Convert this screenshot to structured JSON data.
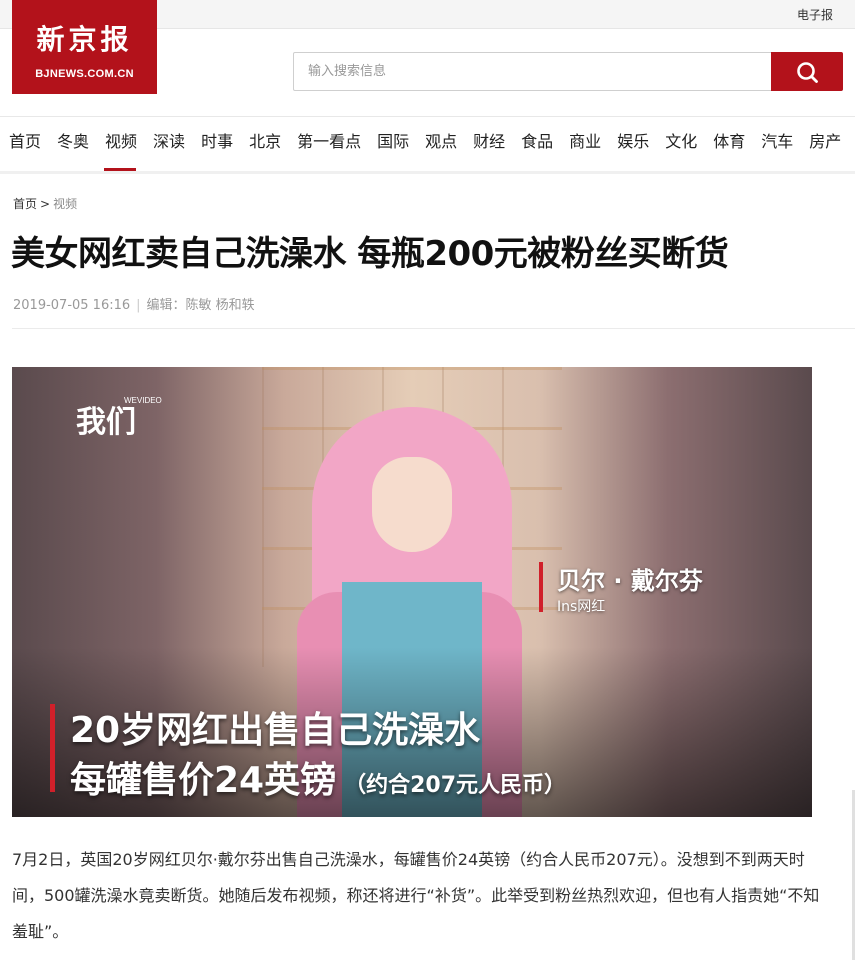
{
  "topbar": {
    "epaper_label": "电子报"
  },
  "logo": {
    "cn": "新京报",
    "en": "BJNEWS.COM.CN"
  },
  "search": {
    "placeholder": "输入搜索信息"
  },
  "nav": {
    "items": [
      "首页",
      "冬奥",
      "视频",
      "深读",
      "时事",
      "北京",
      "第一看点",
      "国际",
      "观点",
      "财经",
      "食品",
      "商业",
      "娱乐",
      "文化",
      "体育",
      "汽车",
      "房产"
    ],
    "active": "视频"
  },
  "breadcrumb": {
    "home": "首页",
    "separator": ">",
    "current": "视频"
  },
  "article": {
    "title": "美女网红卖自己洗澡水 每瓶200元被粉丝买断货",
    "datetime": "2019-07-05 16:16",
    "separator": "|",
    "editor": "编辑：陈敏 杨和轶",
    "body": "7月2日，英国20岁网红贝尔·戴尔芬出售自己洗澡水，每罐售价24英镑（约合人民币207元）。没想到不到两天时间，500罐洗澡水竟卖断货。她随后发布视频，称还将进行“补货”。此举受到粉丝热烈欢迎，但也有人指责她“不知羞耻”。"
  },
  "video": {
    "brand_logo": "我们",
    "brand_sub": "WEVIDEO",
    "person_name": "贝尔 · 戴尔芬",
    "person_desc": "Ins网红",
    "caption_line1": "20岁网红出售自己洗澡水",
    "caption_line2": "每罐售价24英镑",
    "caption_note": "（约合207元人民币）"
  },
  "colors": {
    "brand_red": "#b3121b",
    "caption_red": "#d0202a"
  }
}
